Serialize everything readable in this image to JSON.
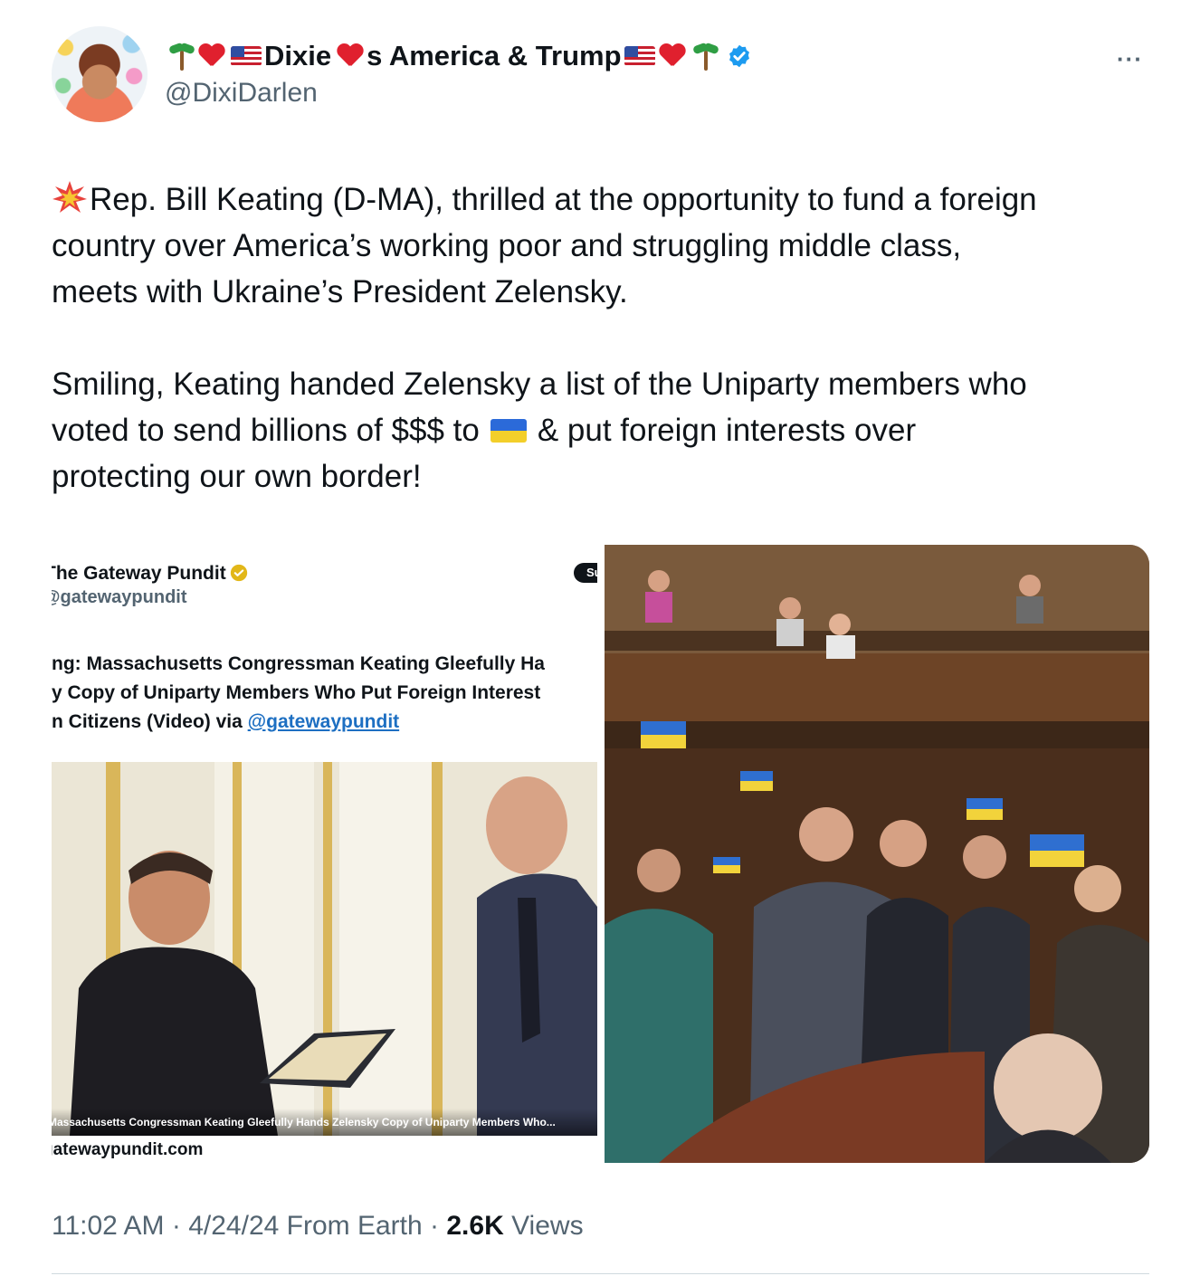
{
  "author": {
    "display_name_1": "Dixie",
    "display_name_2": "s America & Trump",
    "handle": "@DixiDarlen",
    "verified": true,
    "icons": [
      "palm-tree-icon",
      "red-heart-icon",
      "us-flag-icon",
      "red-heart-icon",
      "us-flag-icon",
      "red-heart-icon",
      "palm-tree-icon",
      "verified-badge-icon"
    ]
  },
  "menu": {
    "more_label": "···"
  },
  "post": {
    "para1": "Rep. Bill Keating (D-MA), thrilled at the opportunity to fund a foreign\ncountry over America’s working poor and struggling middle class,\nmeets with Ukraine’s President Zelensky.",
    "para2_a": "Smiling, Keating handed Zelensky a list of the Uniparty members who\nvoted to send billions of $$$ to",
    "para2_b": "& put foreign interests over\nprotecting our own border!",
    "lead_icon": "collision-icon",
    "inline_flag": "ukraine-flag-icon"
  },
  "embed": {
    "source_name": "The Gateway Pundit",
    "source_handle": "@gatewaypundit",
    "subscribe_label": "Su",
    "headline_l1": "ng: Massachusetts Congressman Keating Gleefully Ha",
    "headline_l2": "y Copy of Uniparty Members Who Put Foreign Interest",
    "headline_l3": "n Citizens (Video) via ",
    "headline_link": "@gatewaypundit",
    "card_caption": "Massachusetts Congressman Keating Gleefully Hands Zelensky Copy of Uniparty Members Who...",
    "domain": "gatewaypundit.com"
  },
  "footer": {
    "time": "11:02 AM",
    "date": "4/24/24",
    "source": "From Earth",
    "views_count": "2.6K",
    "views_label": "Views",
    "sep": "·"
  },
  "colors": {
    "text": "#0f1419",
    "secondary": "#536471",
    "verified_blue": "#1d9bf0",
    "link": "#1d6fc2",
    "divider": "#cfd9de"
  }
}
